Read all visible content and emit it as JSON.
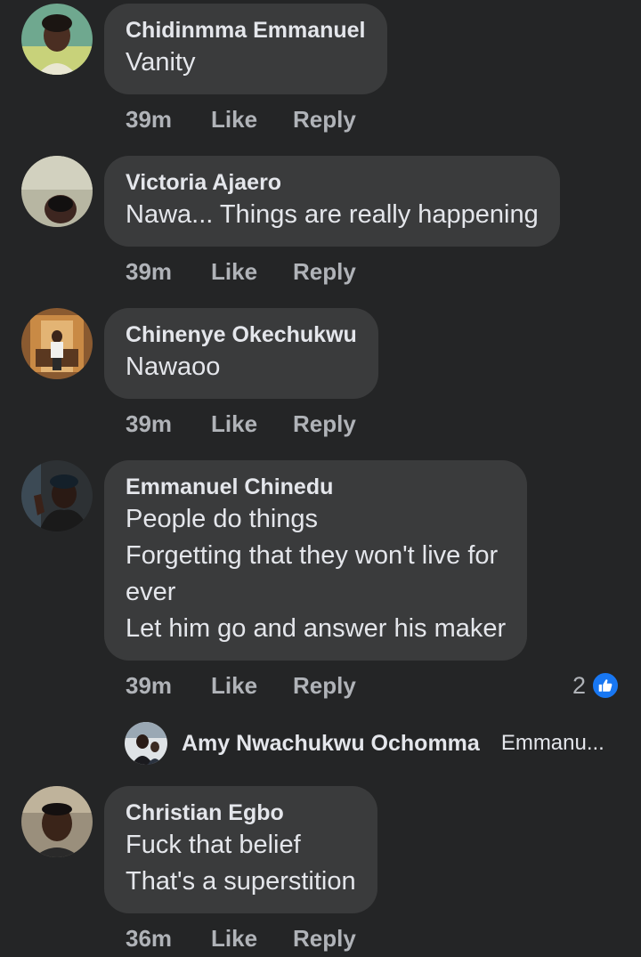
{
  "comments": [
    {
      "author": "Chidinmma Emmanuel",
      "lines": [
        "Vanity"
      ],
      "time": "39m",
      "like_label": "Like",
      "reply_label": "Reply"
    },
    {
      "author": "Victoria Ajaero",
      "lines": [
        "Nawa... Things are really happening"
      ],
      "time": "39m",
      "like_label": "Like",
      "reply_label": "Reply"
    },
    {
      "author": "Chinenye Okechukwu",
      "lines": [
        "Nawaoo"
      ],
      "time": "39m",
      "like_label": "Like",
      "reply_label": "Reply"
    },
    {
      "author": "Emmanuel Chinedu",
      "lines": [
        "People do things",
        "Forgetting that they won't live for",
        "ever",
        "Let him go and answer his maker"
      ],
      "time": "39m",
      "like_label": "Like",
      "reply_label": "Reply",
      "reaction_count": "2",
      "reaction_icon": "thumbs-up-icon",
      "reply_preview": {
        "author": "Amy Nwachukwu Ochomma",
        "text": "Emmanu..."
      }
    },
    {
      "author": "Christian Egbo",
      "lines": [
        "Fuck that belief",
        "That's a superstition"
      ],
      "time": "36m",
      "like_label": "Like",
      "reply_label": "Reply"
    }
  ],
  "colors": {
    "background": "#242526",
    "bubble": "#3a3b3c",
    "primary_text": "#e4e6eb",
    "secondary_text": "#b0b3b8",
    "like_blue": "#1877f2"
  }
}
